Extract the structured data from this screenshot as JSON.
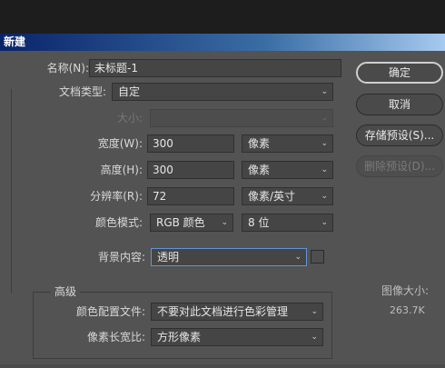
{
  "window": {
    "title": "新建"
  },
  "form": {
    "name": {
      "label": "名称(N):",
      "value": "未标题-1"
    },
    "doc_type": {
      "label": "文档类型:",
      "value": "自定"
    },
    "size": {
      "label": "大小:",
      "value": ""
    },
    "width": {
      "label": "宽度(W):",
      "value": "300",
      "unit": "像素"
    },
    "height": {
      "label": "高度(H):",
      "value": "300",
      "unit": "像素"
    },
    "resolution": {
      "label": "分辨率(R):",
      "value": "72",
      "unit": "像素/英寸"
    },
    "color_mode": {
      "label": "颜色模式:",
      "value": "RGB 颜色",
      "bits": "8 位"
    },
    "background": {
      "label": "背景内容:",
      "value": "透明"
    }
  },
  "advanced": {
    "title": "高级",
    "color_profile": {
      "label": "颜色配置文件:",
      "value": "不要对此文档进行色彩管理"
    },
    "pixel_aspect": {
      "label": "像素长宽比:",
      "value": "方形像素"
    }
  },
  "buttons": {
    "ok": "确定",
    "cancel": "取消",
    "save_preset": "存储预设(S)...",
    "delete_preset": "删除预设(D)..."
  },
  "info": {
    "image_size_label": "图像大小:",
    "image_size_value": "263.7K"
  },
  "icons": {
    "dropdown": "chevron-down-icon"
  },
  "colors": {
    "titlebar_start": "#0a246a",
    "titlebar_end": "#a6caf0",
    "panel": "#535353",
    "focus": "#5f95d6"
  }
}
